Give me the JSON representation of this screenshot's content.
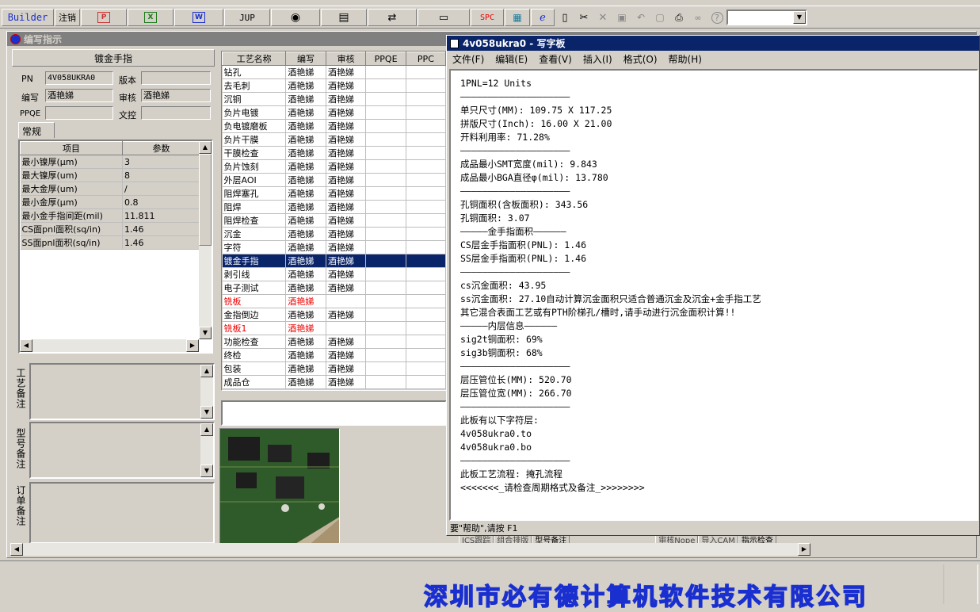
{
  "toolbar": {
    "builder_label": "Builder",
    "logout_label": "注销",
    "jup_label": "JUP",
    "spc_label": "SPC",
    "combo_value": ""
  },
  "child_window": {
    "title": "编写指示",
    "section_title": "镀金手指",
    "fields": {
      "pn_label": "PN",
      "pn_value": "4V058UKRA0",
      "version_label": "版本",
      "version_value": "",
      "writer_label": "编写",
      "writer_value": "酒艳娣",
      "review_label": "审核",
      "review_value": "酒艳娣",
      "ppqe_label": "PPQE",
      "ppqe_value": "",
      "doc_ctrl_label": "文控",
      "doc_ctrl_value": ""
    },
    "tab_label": "常规",
    "param_table": {
      "headers": [
        "项目",
        "参数"
      ],
      "rows": [
        [
          "最小镍厚(μm)",
          "3"
        ],
        [
          "最大镍厚(um)",
          "8"
        ],
        [
          "最大金厚(um)",
          "/"
        ],
        [
          "最小金厚(μm)",
          "0.8"
        ],
        [
          "最小金手指间距(mil)",
          "11.811"
        ],
        [
          "CS面pnl面积(sq/in)",
          "1.46"
        ],
        [
          "SS面pnl面积(sq/in)",
          "1.46"
        ]
      ]
    },
    "remarks": {
      "process_label": "工艺备注",
      "model_label": "型号备注",
      "order_label": "订单备注"
    },
    "process_table": {
      "headers": [
        "工艺名称",
        "编写",
        "审核",
        "PPQE",
        "PPC"
      ],
      "rows": [
        {
          "name": "钻孔",
          "writer": "酒艳娣",
          "review": "酒艳娣"
        },
        {
          "name": "去毛刺",
          "writer": "酒艳娣",
          "review": "酒艳娣"
        },
        {
          "name": "沉铜",
          "writer": "酒艳娣",
          "review": "酒艳娣"
        },
        {
          "name": "负片电镀",
          "writer": "酒艳娣",
          "review": "酒艳娣"
        },
        {
          "name": "负电镀磨板",
          "writer": "酒艳娣",
          "review": "酒艳娣"
        },
        {
          "name": "负片干膜",
          "writer": "酒艳娣",
          "review": "酒艳娣"
        },
        {
          "name": "干膜检查",
          "writer": "酒艳娣",
          "review": "酒艳娣"
        },
        {
          "name": "负片蚀刻",
          "writer": "酒艳娣",
          "review": "酒艳娣"
        },
        {
          "name": "外层AOI",
          "writer": "酒艳娣",
          "review": "酒艳娣"
        },
        {
          "name": "阻焊塞孔",
          "writer": "酒艳娣",
          "review": "酒艳娣"
        },
        {
          "name": "阻焊",
          "writer": "酒艳娣",
          "review": "酒艳娣"
        },
        {
          "name": "阻焊检查",
          "writer": "酒艳娣",
          "review": "酒艳娣"
        },
        {
          "name": "沉金",
          "writer": "酒艳娣",
          "review": "酒艳娣"
        },
        {
          "name": "字符",
          "writer": "酒艳娣",
          "review": "酒艳娣"
        },
        {
          "name": "镀金手指",
          "writer": "酒艳娣",
          "review": "酒艳娣"
        },
        {
          "name": "剥引线",
          "writer": "酒艳娣",
          "review": "酒艳娣"
        },
        {
          "name": "电子测试",
          "writer": "酒艳娣",
          "review": "酒艳娣"
        },
        {
          "name": "铣板",
          "writer": "酒艳娣",
          "review": ""
        },
        {
          "name": "金指倒边",
          "writer": "酒艳娣",
          "review": "酒艳娣"
        },
        {
          "name": "铣板1",
          "writer": "酒艳娣",
          "review": ""
        },
        {
          "name": "功能检查",
          "writer": "酒艳娣",
          "review": "酒艳娣"
        },
        {
          "name": "终检",
          "writer": "酒艳娣",
          "review": "酒艳娣"
        },
        {
          "name": "包装",
          "writer": "酒艳娣",
          "review": "酒艳娣"
        },
        {
          "name": "成品仓",
          "writer": "酒艳娣",
          "review": "酒艳娣"
        }
      ]
    },
    "bottom_tabs": [
      "ICS跟踪",
      "组合排版",
      "型号备注",
      "审核Nope",
      "导入CAM",
      "指示检查"
    ]
  },
  "wordpad": {
    "title": "4v058ukra0 - 写字板",
    "menu": [
      "文件(F)",
      "编辑(E)",
      "查看(V)",
      "插入(I)",
      "格式(O)",
      "帮助(H)"
    ],
    "lines": [
      "1PNL=12 Units",
      "————————————————————",
      "单只尺寸(MM): 109.75 X 117.25",
      "拼版尺寸(Inch): 16.00 X 21.00",
      "开料利用率: 71.28%",
      "————————————————————",
      "成品最小SMT宽度(mil): 9.843",
      "成品最小BGA直径φ(mil): 13.780",
      "————————————————————",
      "孔铜面积(含板面积): 343.56",
      "孔铜面积: 3.07",
      "—————金手指面积——————",
      "CS层金手指面积(PNL): 1.46",
      "SS层金手指面积(PNL): 1.46",
      "————————————————————",
      "cs沉金面积: 43.95",
      "ss沉金面积: 27.10自动计算沉金面积只适合普通沉金及沉金+金手指工艺",
      "其它混合表面工艺或有PTH阶梯孔/槽时,请手动进行沉金面积计算!!",
      "—————内层信息——————",
      "sig2t铜面积: 69%",
      "sig3b铜面积: 68%",
      "————————————————————",
      "层压管位长(MM): 520.70",
      "层压管位宽(MM): 266.70",
      "————————————————————",
      "此板有以下字符层:",
      "4v058ukra0.to",
      "4v058ukra0.bo",
      "————————————————————",
      "此板工艺流程: 掩孔流程",
      "<<<<<<<_请检查周期格式及备注_>>>>>>>>"
    ],
    "status": "要\"帮助\",请按 F1"
  },
  "company": "深圳市必有德计算机软件技术有限公司"
}
